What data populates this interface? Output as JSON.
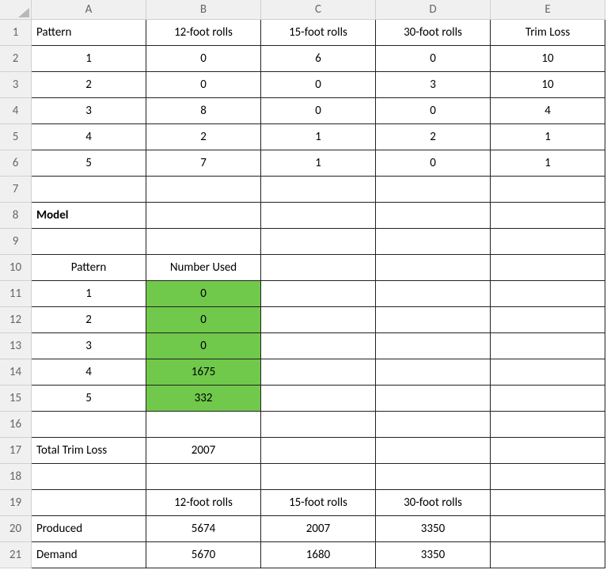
{
  "cols": [
    "A",
    "B",
    "C",
    "D",
    "E"
  ],
  "rows": [
    "1",
    "2",
    "3",
    "4",
    "5",
    "6",
    "7",
    "8",
    "9",
    "10",
    "11",
    "12",
    "13",
    "14",
    "15",
    "16",
    "17",
    "18",
    "19",
    "20",
    "21"
  ],
  "r1": {
    "A": "Pattern",
    "B": "12-foot rolls",
    "C": "15-foot rolls",
    "D": "30-foot rolls",
    "E": "Trim Loss"
  },
  "r2": {
    "A": "1",
    "B": "0",
    "C": "6",
    "D": "0",
    "E": "10"
  },
  "r3": {
    "A": "2",
    "B": "0",
    "C": "0",
    "D": "3",
    "E": "10"
  },
  "r4": {
    "A": "3",
    "B": "8",
    "C": "0",
    "D": "0",
    "E": "4"
  },
  "r5": {
    "A": "4",
    "B": "2",
    "C": "1",
    "D": "2",
    "E": "1"
  },
  "r6": {
    "A": "5",
    "B": "7",
    "C": "1",
    "D": "0",
    "E": "1"
  },
  "r8": {
    "A": "Model"
  },
  "r10": {
    "A": "Pattern",
    "B": "Number Used"
  },
  "r11": {
    "A": "1",
    "B": "0"
  },
  "r12": {
    "A": "2",
    "B": "0"
  },
  "r13": {
    "A": "3",
    "B": "0"
  },
  "r14": {
    "A": "4",
    "B": "1675"
  },
  "r15": {
    "A": "5",
    "B": "332"
  },
  "r17": {
    "A": "Total Trim Loss",
    "B": "2007"
  },
  "r19": {
    "B": "12-foot rolls",
    "C": "15-foot rolls",
    "D": "30-foot rolls"
  },
  "r20": {
    "A": "Produced",
    "B": "5674",
    "C": "2007",
    "D": "3350"
  },
  "r21": {
    "A": "Demand",
    "B": "5670",
    "C": "1680",
    "D": "3350"
  }
}
